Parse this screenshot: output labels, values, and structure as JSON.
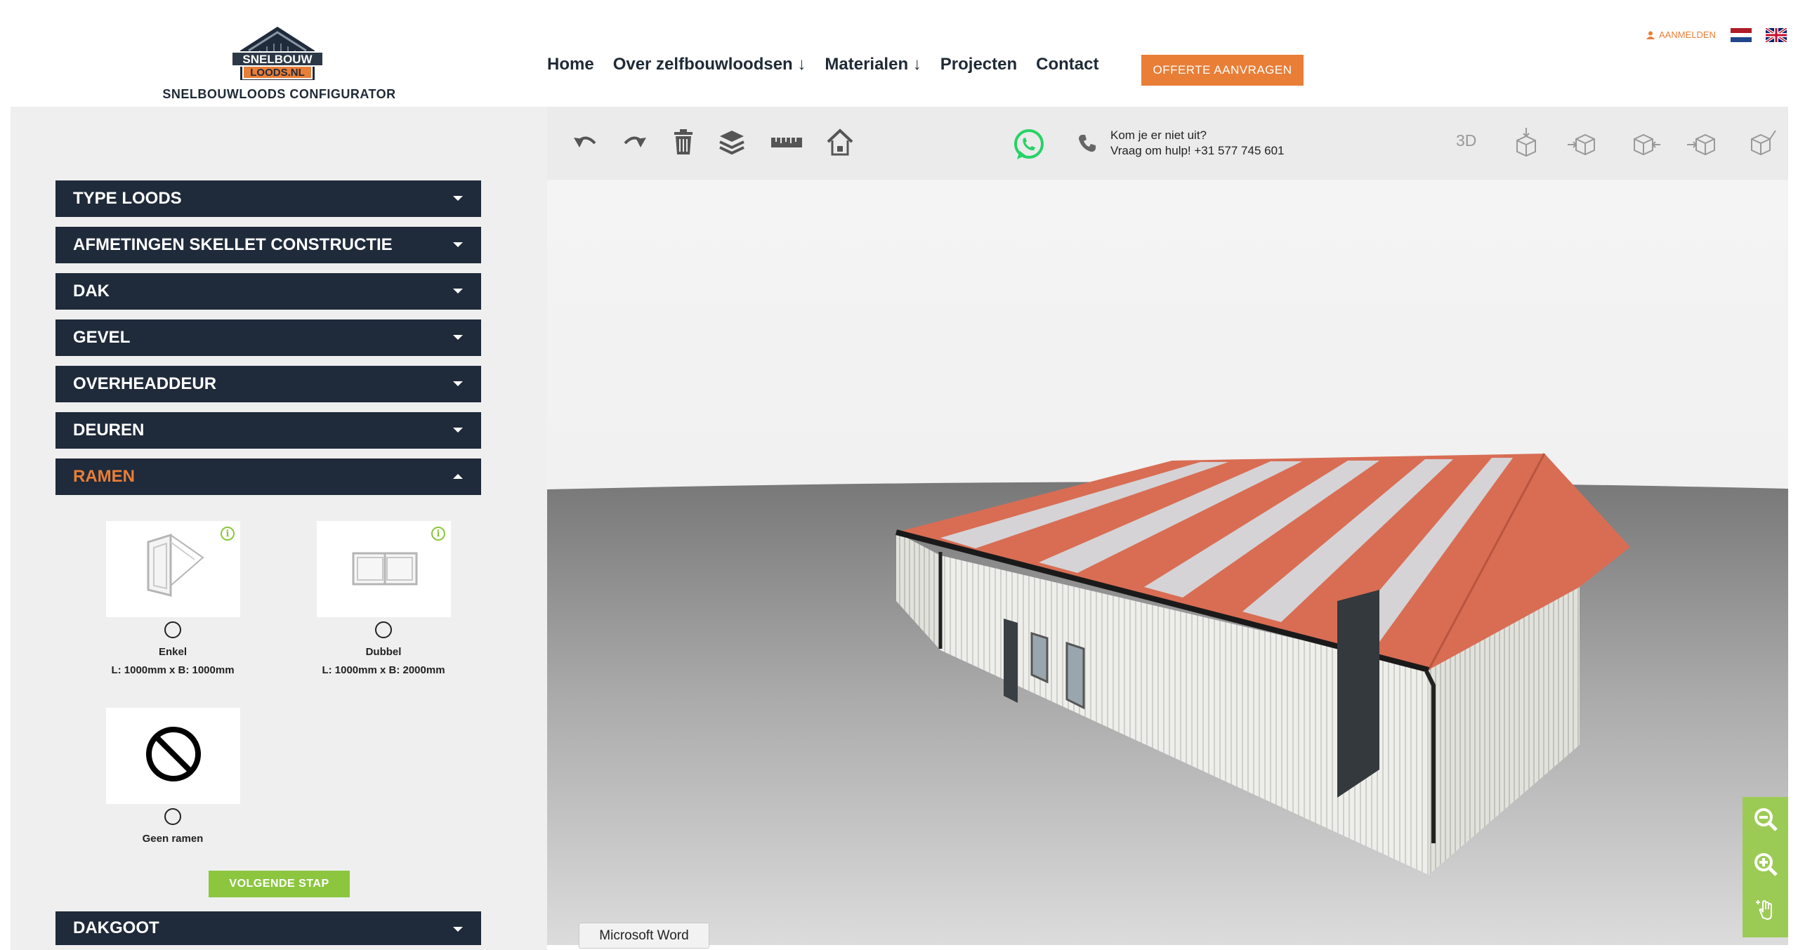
{
  "header": {
    "logo_text_line1": "SNELBOUW",
    "logo_text_line2": "LOODS.NL",
    "subtitle": "SNELBOUWLOODS CONFIGURATOR",
    "nav": [
      {
        "label": "Home"
      },
      {
        "label": "Over zelfbouwloodsen ↓"
      },
      {
        "label": "Materialen ↓"
      },
      {
        "label": "Projecten"
      },
      {
        "label": "Contact"
      }
    ],
    "cta_label": "OFFERTE AANVRAGEN",
    "login_label": "AANMELDEN",
    "languages": [
      "nl-flag-icon",
      "uk-flag-icon"
    ]
  },
  "accordion": {
    "sections": [
      {
        "label": "TYPE LOODS",
        "open": false
      },
      {
        "label": "AFMETINGEN SKELLET CONSTRUCTIE",
        "open": false
      },
      {
        "label": "DAK",
        "open": false
      },
      {
        "label": "GEVEL",
        "open": false
      },
      {
        "label": "OVERHEADDEUR",
        "open": false
      },
      {
        "label": "DEUREN",
        "open": false
      },
      {
        "label": "RAMEN",
        "open": true
      }
    ],
    "after": {
      "label": "DAKGOOT",
      "open": false
    }
  },
  "ramen_options": [
    {
      "name": "Enkel",
      "dims": "L: 1000mm x B: 1000mm",
      "icon": "single-window-icon"
    },
    {
      "name": "Dubbel",
      "dims": "L: 1000mm x B: 2000mm",
      "icon": "double-window-icon"
    },
    {
      "name": "Geen ramen",
      "dims": "",
      "icon": "no-windows-icon"
    }
  ],
  "next_step_label": "VOLGENDE STAP",
  "toolbar": {
    "tools": [
      "undo-icon",
      "redo-icon",
      "trash-icon",
      "layers-icon",
      "ruler-icon",
      "house-icon"
    ],
    "help_line1": "Kom je er niet uit?",
    "help_line2": "Vraag om hulp! +31 577 745 601",
    "view_3d_label": "3D",
    "views": [
      "view-top-icon",
      "view-front-icon",
      "view-right-icon",
      "view-left-icon",
      "view-perspective-icon"
    ]
  },
  "zoom": [
    "zoom-out-icon",
    "zoom-in-icon",
    "pan-hand-icon"
  ],
  "tooltip_text": "Microsoft Word",
  "colors": {
    "accent": "#e97e37",
    "navy": "#1f2a3a",
    "green": "#8cc63f",
    "whatsapp": "#25d366"
  }
}
